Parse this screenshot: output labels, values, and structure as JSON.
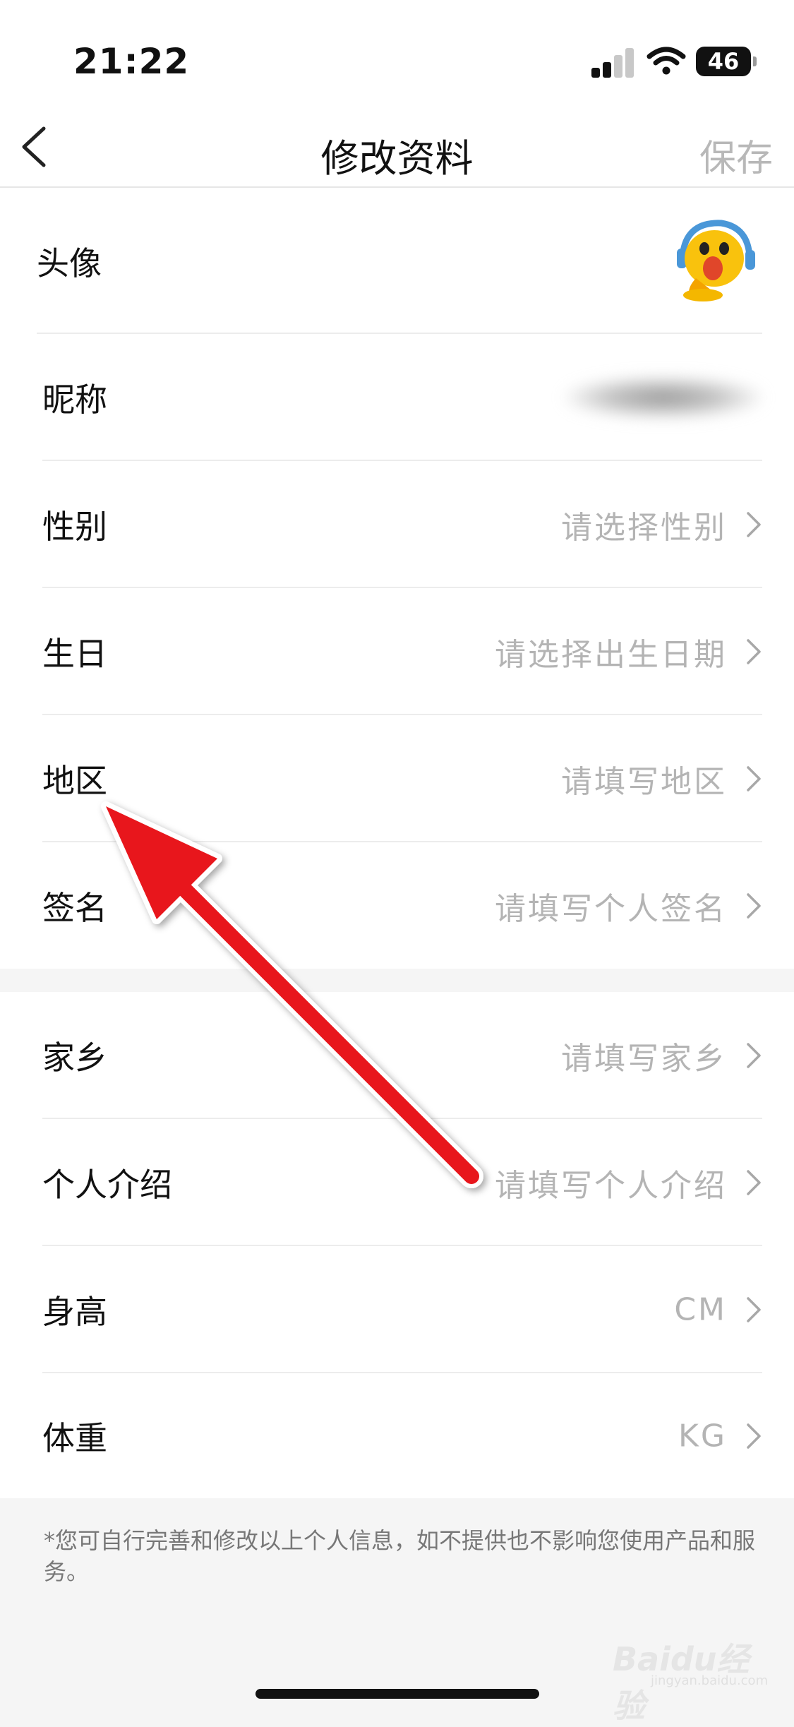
{
  "status_bar": {
    "time": "21:22",
    "battery": "46"
  },
  "nav": {
    "title": "修改资料",
    "save_label": "保存"
  },
  "profile": {
    "avatar_label": "头像",
    "nickname_label": "昵称",
    "items": [
      {
        "label": "性别",
        "placeholder": "请选择性别"
      },
      {
        "label": "生日",
        "placeholder": "请选择出生日期"
      },
      {
        "label": "地区",
        "placeholder": "请填写地区"
      },
      {
        "label": "签名",
        "placeholder": "请填写个人签名"
      }
    ]
  },
  "details": {
    "items": [
      {
        "label": "家乡",
        "placeholder": "请填写家乡"
      },
      {
        "label": "个人介绍",
        "placeholder": "请填写个人介绍"
      },
      {
        "label": "身高",
        "placeholder": "CM"
      },
      {
        "label": "体重",
        "placeholder": "KG"
      }
    ]
  },
  "footnote": "*您可自行完善和修改以上个人信息，如不提供也不影响您使用产品和服务。",
  "watermark": {
    "text": "Baidu经验",
    "sub": "jingyan.baidu.com"
  },
  "colors": {
    "placeholder": "#b4b4b4",
    "annotation_arrow": "#e8141c",
    "save": "#b8b8b8"
  },
  "icons": [
    "back-chevron-icon",
    "chevron-right-icon",
    "wifi-icon",
    "signal-icon",
    "battery-icon"
  ]
}
